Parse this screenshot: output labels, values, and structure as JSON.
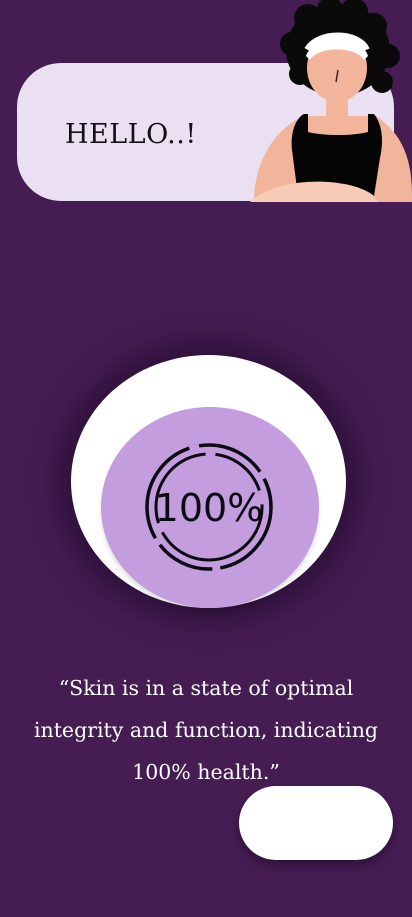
{
  "greeting": {
    "text": "HELLO..!"
  },
  "score": {
    "icon": "hundred-percent-circle-icon",
    "value": "100%"
  },
  "message": {
    "quote": "“Skin is in a state of optimal integrity and function, indicating 100% health.”"
  },
  "colors": {
    "background": "#461d53",
    "card": "#ebdff2",
    "disc": "#c39ddd",
    "button": "#ffffff"
  }
}
